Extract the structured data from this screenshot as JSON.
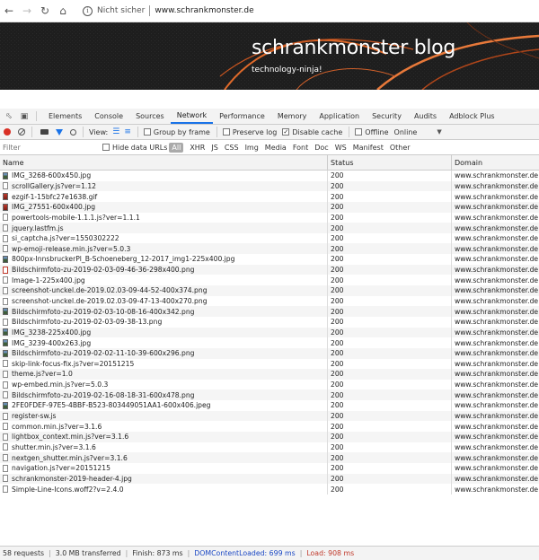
{
  "browser": {
    "security_text": "Nicht sicher",
    "url": "www.schrankmonster.de"
  },
  "banner": {
    "title": "schrankmonster blog",
    "subtitle": "technology-ninja!"
  },
  "devtools": {
    "tabs": [
      "Elements",
      "Console",
      "Sources",
      "Network",
      "Performance",
      "Memory",
      "Application",
      "Security",
      "Audits",
      "Adblock Plus"
    ],
    "active_tab": "Network",
    "toolbar": {
      "view_label": "View:",
      "group_by_frame": "Group by frame",
      "preserve_log": "Preserve log",
      "disable_cache": "Disable cache",
      "offline": "Offline",
      "throttle": "Online"
    },
    "filter": {
      "placeholder": "Filter",
      "hide_data_urls": "Hide data URLs",
      "types": [
        "All",
        "XHR",
        "JS",
        "CSS",
        "Img",
        "Media",
        "Font",
        "Doc",
        "WS",
        "Manifest",
        "Other"
      ]
    },
    "columns": {
      "name": "Name",
      "status": "Status",
      "domain": "Domain"
    },
    "rows": [
      {
        "name": "IMG_3268-600x450.jpg",
        "status": "200",
        "domain": "www.schrankmonster.de",
        "icon": "img"
      },
      {
        "name": "scrollGallery.js?ver=1.12",
        "status": "200",
        "domain": "www.schrankmonster.de",
        "icon": "doc"
      },
      {
        "name": "ezgif-1-15bfc27e1638.gif",
        "status": "200",
        "domain": "www.schrankmonster.de",
        "icon": "gif"
      },
      {
        "name": "IMG_27551-600x400.jpg",
        "status": "200",
        "domain": "www.schrankmonster.de",
        "icon": "gif"
      },
      {
        "name": "powertools-mobile-1.1.1.js?ver=1.1.1",
        "status": "200",
        "domain": "www.schrankmonster.de",
        "icon": "doc"
      },
      {
        "name": "jquery.lastfm.js",
        "status": "200",
        "domain": "www.schrankmonster.de",
        "icon": "doc"
      },
      {
        "name": "si_captcha.js?ver=1550302222",
        "status": "200",
        "domain": "www.schrankmonster.de",
        "icon": "doc"
      },
      {
        "name": "wp-emoji-release.min.js?ver=5.0.3",
        "status": "200",
        "domain": "www.schrankmonster.de",
        "icon": "doc"
      },
      {
        "name": "800px-InnsbruckerPl_B-Schoeneberg_12-2017_img1-225x400.jpg",
        "status": "200",
        "domain": "www.schrankmonster.de",
        "icon": "img"
      },
      {
        "name": "Bildschirmfoto-zu-2019-02-03-09-46-36-298x400.png",
        "status": "200",
        "domain": "www.schrankmonster.de",
        "icon": "red"
      },
      {
        "name": "Image-1-225x400.jpg",
        "status": "200",
        "domain": "www.schrankmonster.de",
        "icon": "doc"
      },
      {
        "name": "screenshot-unckel.de-2019.02.03-09-44-52-400x374.png",
        "status": "200",
        "domain": "www.schrankmonster.de",
        "icon": "doc"
      },
      {
        "name": "screenshot-unckel.de-2019.02.03-09-47-13-400x270.png",
        "status": "200",
        "domain": "www.schrankmonster.de",
        "icon": "doc"
      },
      {
        "name": "Bildschirmfoto-zu-2019-02-03-10-08-16-400x342.png",
        "status": "200",
        "domain": "www.schrankmonster.de",
        "icon": "img"
      },
      {
        "name": "Bildschirmfoto-zu-2019-02-03-09-38-13.png",
        "status": "200",
        "domain": "www.schrankmonster.de",
        "icon": "doc"
      },
      {
        "name": "IMG_3238-225x400.jpg",
        "status": "200",
        "domain": "www.schrankmonster.de",
        "icon": "img"
      },
      {
        "name": "IMG_3239-400x263.jpg",
        "status": "200",
        "domain": "www.schrankmonster.de",
        "icon": "img"
      },
      {
        "name": "Bildschirmfoto-zu-2019-02-02-11-10-39-600x296.png",
        "status": "200",
        "domain": "www.schrankmonster.de",
        "icon": "img"
      },
      {
        "name": "skip-link-focus-fix.js?ver=20151215",
        "status": "200",
        "domain": "www.schrankmonster.de",
        "icon": "doc"
      },
      {
        "name": "theme.js?ver=1.0",
        "status": "200",
        "domain": "www.schrankmonster.de",
        "icon": "doc"
      },
      {
        "name": "wp-embed.min.js?ver=5.0.3",
        "status": "200",
        "domain": "www.schrankmonster.de",
        "icon": "doc"
      },
      {
        "name": "Bildschirmfoto-zu-2019-02-16-08-18-31-600x478.png",
        "status": "200",
        "domain": "www.schrankmonster.de",
        "icon": "doc"
      },
      {
        "name": "2FE0FDEF-97E5-4BBF-B523-803449051AA1-600x406.jpeg",
        "status": "200",
        "domain": "www.schrankmonster.de",
        "icon": "img"
      },
      {
        "name": "register-sw.js",
        "status": "200",
        "domain": "www.schrankmonster.de",
        "icon": "doc"
      },
      {
        "name": "common.min.js?ver=3.1.6",
        "status": "200",
        "domain": "www.schrankmonster.de",
        "icon": "doc"
      },
      {
        "name": "lightbox_context.min.js?ver=3.1.6",
        "status": "200",
        "domain": "www.schrankmonster.de",
        "icon": "doc"
      },
      {
        "name": "shutter.min.js?ver=3.1.6",
        "status": "200",
        "domain": "www.schrankmonster.de",
        "icon": "doc"
      },
      {
        "name": "nextgen_shutter.min.js?ver=3.1.6",
        "status": "200",
        "domain": "www.schrankmonster.de",
        "icon": "doc"
      },
      {
        "name": "navigation.js?ver=20151215",
        "status": "200",
        "domain": "www.schrankmonster.de",
        "icon": "doc"
      },
      {
        "name": "schrankmonster-2019-header-4.jpg",
        "status": "200",
        "domain": "www.schrankmonster.de",
        "icon": "doc"
      },
      {
        "name": "Simple-Line-Icons.woff2?v=2.4.0",
        "status": "200",
        "domain": "www.schrankmonster.de",
        "icon": "doc"
      }
    ],
    "summary": {
      "requests": "58 requests",
      "transferred": "3.0 MB transferred",
      "finish": "Finish: 873 ms",
      "dom_loaded": "DOMContentLoaded: 699 ms",
      "load": "Load: 908 ms"
    }
  }
}
